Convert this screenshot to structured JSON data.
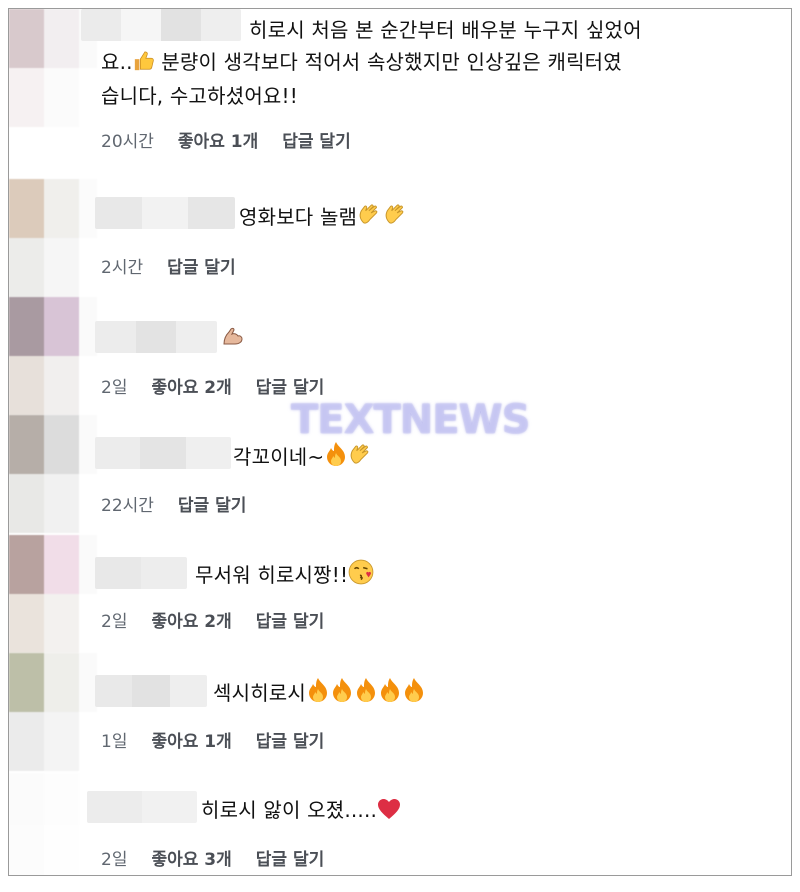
{
  "watermark": "TEXTNEWS",
  "comments": [
    {
      "line1": "히로시 처음 본 순간부터 배우분 누구지 싶었어",
      "line2": "요..",
      "line2b": " 분량이 생각보다 적어서 속상했지만 인상깊은 캐릭터였",
      "line3": "습니다, 수고하셨어요!!",
      "time": "20시간",
      "likes": "좋아요 1개",
      "reply": "답글 달기"
    },
    {
      "text": "영화보다 놀램",
      "time": "2시간",
      "reply": "답글 달기"
    },
    {
      "text": "",
      "time": "2일",
      "likes": "좋아요 2개",
      "reply": "답글 달기"
    },
    {
      "text": "각꼬이네~",
      "time": "22시간",
      "reply": "답글 달기"
    },
    {
      "text": "무서워 히로시짱!!",
      "time": "2일",
      "likes": "좋아요 2개",
      "reply": "답글 달기"
    },
    {
      "text": "섹시히로시",
      "time": "1일",
      "likes": "좋아요 1개",
      "reply": "답글 달기"
    },
    {
      "text": "히로시 앓이 오졌.....",
      "time": "2일",
      "likes": "좋아요 3개",
      "reply": "답글 달기"
    }
  ],
  "emoji": [
    "thumbs-up",
    "clapping-hands",
    "flexed-biceps",
    "fire",
    "face-blowing-kiss",
    "red-heart"
  ],
  "colors": {
    "meta": "#606770",
    "fire": "#f4900c",
    "clap": "#ffcc4d",
    "heart": "#dd2e44"
  }
}
